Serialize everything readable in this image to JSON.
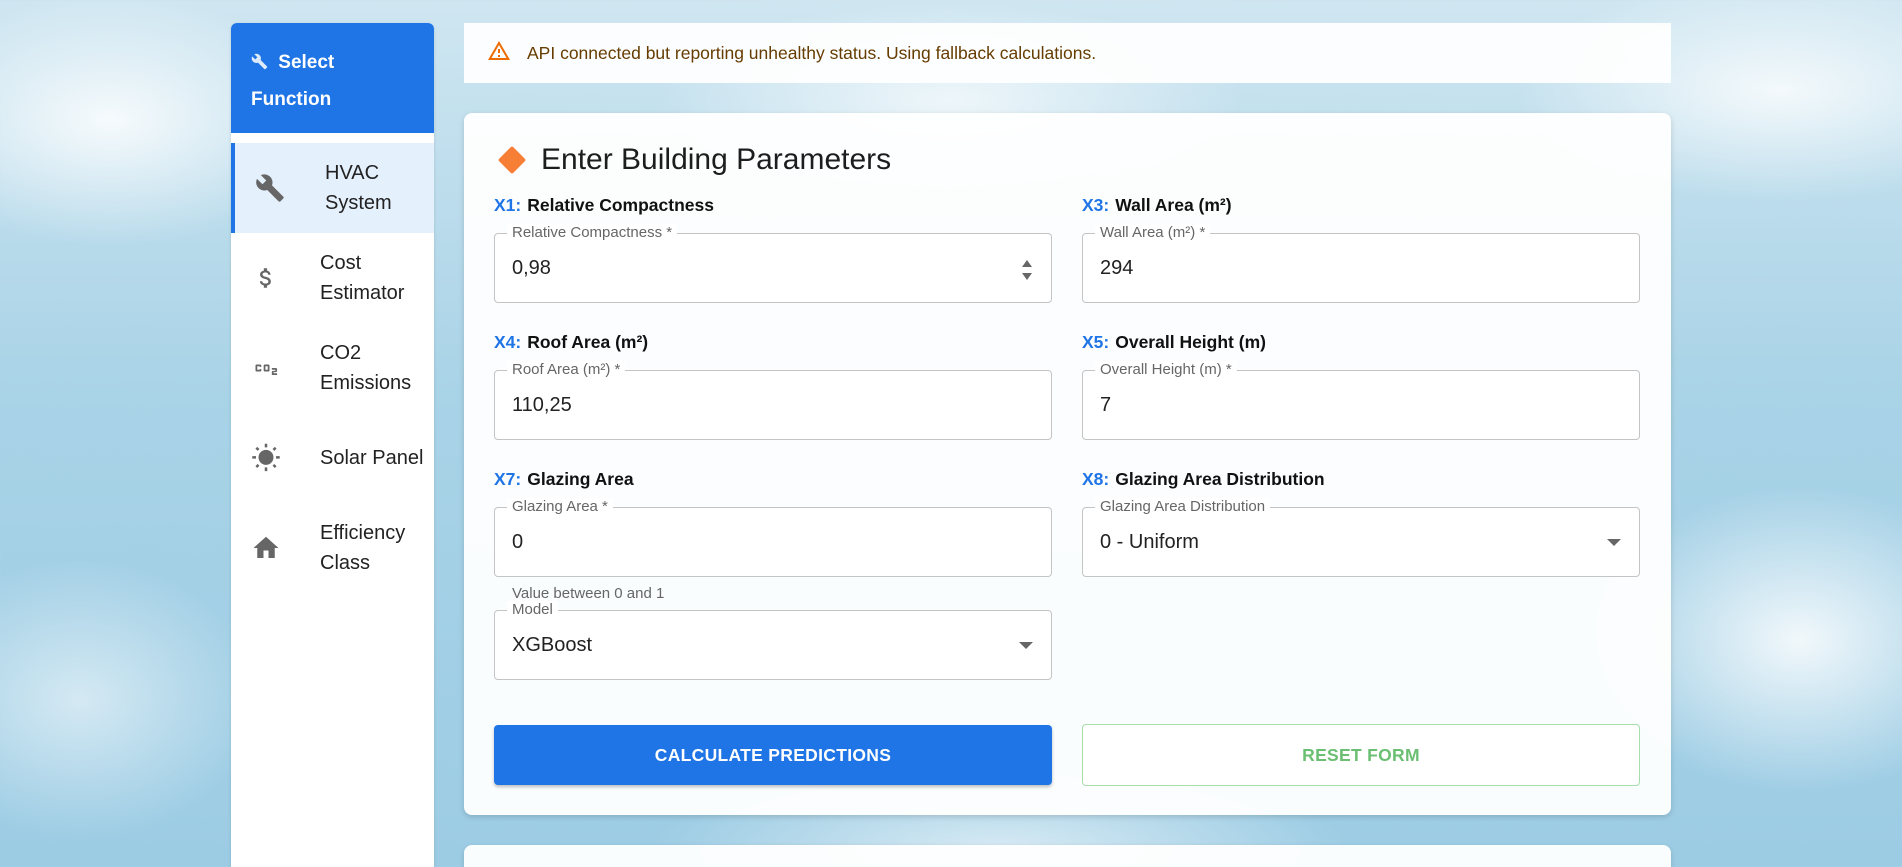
{
  "sidebar": {
    "header": "Select Function",
    "items": [
      {
        "label": "HVAC System",
        "icon": "wrench-icon",
        "active": true
      },
      {
        "label": "Cost Estimator",
        "icon": "dollar-icon",
        "active": false
      },
      {
        "label": "CO2 Emissions",
        "icon": "co2-icon",
        "active": false
      },
      {
        "label": "Solar Panel",
        "icon": "sun-icon",
        "active": false
      },
      {
        "label": "Efficiency Class",
        "icon": "home-icon",
        "active": false
      }
    ]
  },
  "alert": {
    "text": "API connected but reporting unhealthy status. Using fallback calculations.",
    "icon": "warning-icon",
    "color": "#ed6c02"
  },
  "form": {
    "title": "Enter Building Parameters",
    "fields": {
      "x1": {
        "code": "X1:",
        "name": "Relative Compactness",
        "legend": "Relative Compactness *",
        "value": "0,98"
      },
      "x3": {
        "code": "X3:",
        "name": "Wall Area (m²)",
        "legend": "Wall Area (m²) *",
        "value": "294"
      },
      "x4": {
        "code": "X4:",
        "name": "Roof Area (m²)",
        "legend": "Roof Area (m²) *",
        "value": "110,25"
      },
      "x5": {
        "code": "X5:",
        "name": "Overall Height (m)",
        "legend": "Overall Height (m) *",
        "value": "7"
      },
      "x7": {
        "code": "X7:",
        "name": "Glazing Area",
        "legend": "Glazing Area *",
        "value": "0",
        "helper": "Value between 0 and 1"
      },
      "x8": {
        "code": "X8:",
        "name": "Glazing Area Distribution",
        "legend": "Glazing Area Distribution",
        "value": "0 - Uniform"
      },
      "model": {
        "legend": "Model",
        "value": "XGBoost"
      }
    },
    "buttons": {
      "calculate": "CALCULATE PREDICTIONS",
      "reset": "RESET FORM"
    }
  },
  "colors": {
    "primary": "#1f74e6",
    "accent_diamond": "#f77e35",
    "reset_green": "#6bbf73"
  }
}
